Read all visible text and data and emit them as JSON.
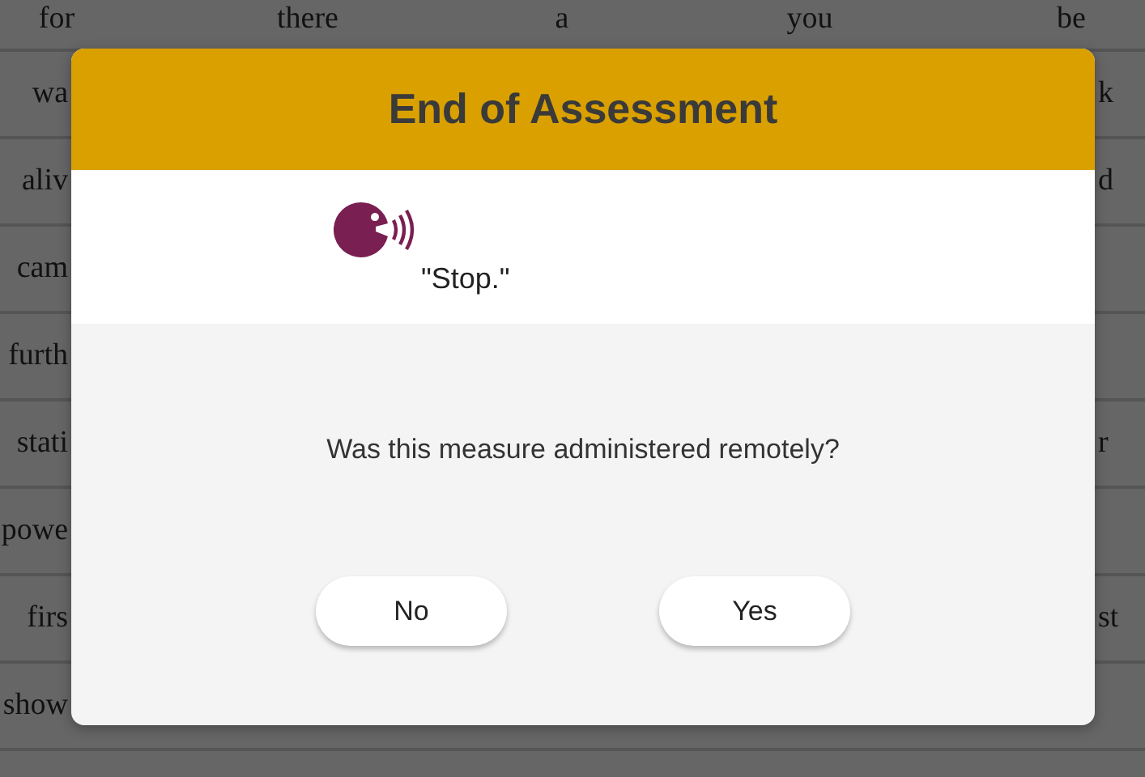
{
  "background_table": {
    "top_row": [
      "for",
      "there",
      "a",
      "you",
      "be"
    ],
    "rows": [
      {
        "column_1": "wa",
        "column_5": "k"
      },
      {
        "column_1": "aliv",
        "column_5": "d"
      },
      {
        "column_1": "cam"
      },
      {
        "column_1": "furth"
      },
      {
        "column_1": "stati",
        "column_5": "r"
      },
      {
        "column_1": "powe"
      },
      {
        "column_1": "firs",
        "column_5": "st"
      },
      {
        "column_1": "show"
      }
    ]
  },
  "dialog": {
    "title": "End of Assessment",
    "prompt": "\"Stop.\"",
    "question": "Was this measure administered remotely?",
    "buttons": [
      {
        "label": "No"
      },
      {
        "label": "Yes"
      }
    ]
  }
}
